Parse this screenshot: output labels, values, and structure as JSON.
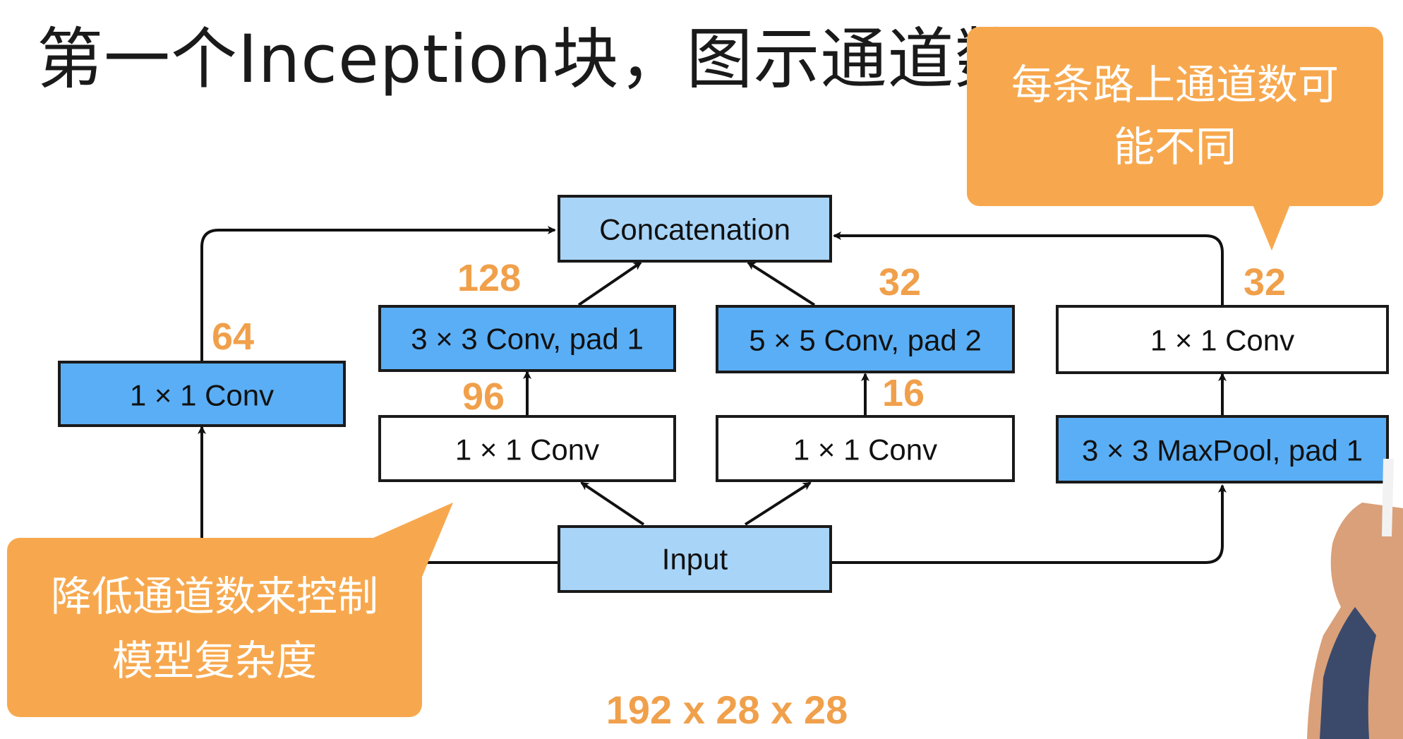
{
  "title": "第一个Inception块，图示通道数",
  "colors": {
    "blue_fill": "#5aaef5",
    "light_blue_fill": "#a8d4f7",
    "white_fill": "#ffffff",
    "border": "#1a1a1a",
    "accent_orange": "#f0a04b",
    "callout_orange": "#f7a84e"
  },
  "diagram": {
    "input_label": "Input",
    "concat_label": "Concatenation",
    "path1": {
      "conv": "1 × 1 Conv",
      "channels": "64"
    },
    "path2": {
      "reduce": "1 × 1 Conv",
      "reduce_channels": "96",
      "conv": "3 × 3 Conv, pad 1",
      "channels": "128"
    },
    "path3": {
      "reduce": "1 × 1 Conv",
      "reduce_channels": "16",
      "conv": "5 × 5 Conv, pad 2",
      "channels": "32"
    },
    "path4": {
      "pool": "3 × 3 MaxPool, pad 1",
      "conv": "1 × 1 Conv",
      "channels": "32"
    },
    "input_dims": "192 x 28 x 28"
  },
  "callouts": {
    "top_right": [
      "每条路上通道数可",
      "能不同"
    ],
    "bottom_left": [
      "降低通道数来控制",
      "模型复杂度"
    ]
  }
}
